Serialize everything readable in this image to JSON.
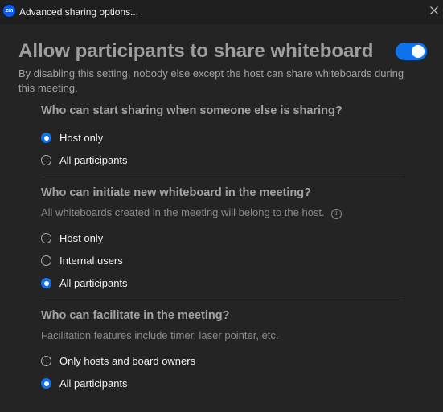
{
  "window": {
    "app_icon": "zm",
    "title": "Advanced sharing options..."
  },
  "main": {
    "title": "Allow participants to share whiteboard",
    "toggle_on": true,
    "description": "By disabling this setting, nobody else except the host can share whiteboards during this meeting."
  },
  "sections": [
    {
      "title": "Who can start sharing when someone else is sharing?",
      "options": [
        {
          "label": "Host only",
          "checked": true
        },
        {
          "label": "All participants",
          "checked": false
        }
      ]
    },
    {
      "title": "Who can initiate new whiteboard in the meeting?",
      "description": "All whiteboards created in the meeting will belong to the host.",
      "info_icon": "i",
      "options": [
        {
          "label": "Host only",
          "checked": false
        },
        {
          "label": "Internal users",
          "checked": false
        },
        {
          "label": "All participants",
          "checked": true
        }
      ]
    },
    {
      "title": "Who can facilitate in the meeting?",
      "description": "Facilitation features include timer, laser pointer, etc.",
      "options": [
        {
          "label": "Only hosts and board owners",
          "checked": false
        },
        {
          "label": "All participants",
          "checked": true
        }
      ]
    }
  ],
  "colors": {
    "accent": "#0e72ed",
    "background": "#242424"
  }
}
